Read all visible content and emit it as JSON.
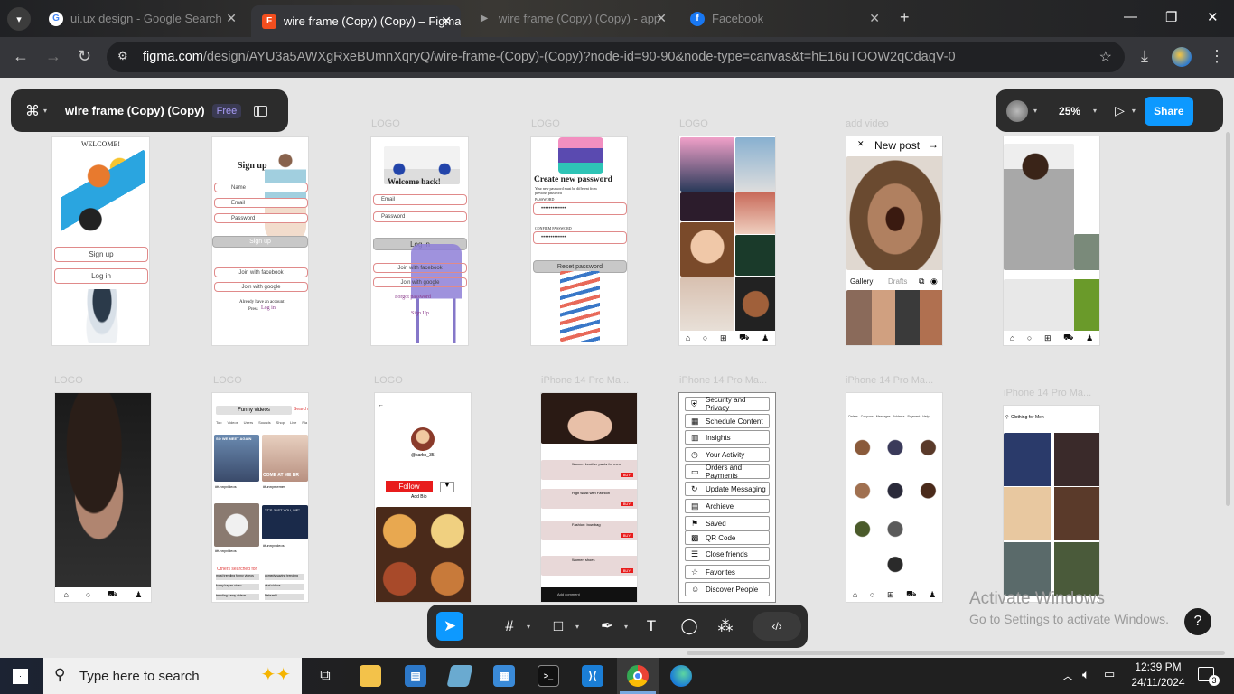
{
  "browser": {
    "tabs": [
      {
        "title": "ui.ux design - Google Search",
        "active": false,
        "icon": "google-icon"
      },
      {
        "title": "wire frame (Copy) (Copy) – Figma",
        "active": true,
        "icon": "figma-icon"
      },
      {
        "title": "wire frame (Copy) (Copy) - app",
        "active": false,
        "icon": "play-icon"
      },
      {
        "title": "Facebook",
        "active": false,
        "icon": "facebook-icon"
      }
    ],
    "url_host": "figma.com",
    "url_path": "/design/AYU3a5AWXgRxeBUmnXqryQ/wire-frame-(Copy)-(Copy)?node-id=90-90&node-type=canvas&t=hE16uTOOW2qCdaqV-0"
  },
  "figma": {
    "file_name": "wire frame (Copy) (Copy)",
    "plan_badge": "Free",
    "zoom": "25%",
    "share_label": "Share",
    "help_label": "?"
  },
  "frames_row1": [
    {
      "label": "",
      "title": "WELCOME!",
      "btn1": "Sign up",
      "btn2": "Log in"
    },
    {
      "label": "",
      "title": "Sign up",
      "f1": "Name",
      "f2": "Email",
      "f3": "Password",
      "btn": "Sign up",
      "s1": "Join with facebook",
      "s2": "Join with google",
      "foot1": "Already have an account",
      "foot2": "Press",
      "foot3": "Log in"
    },
    {
      "label": "LOGO",
      "title": "Welcome back!",
      "f1": "Email",
      "f2": "Password",
      "btn": "Log in",
      "s1": "Join with facebook",
      "s2": "Join with google",
      "forgot": "Forgot password",
      "foot": "Sign Up"
    },
    {
      "label": "LOGO",
      "title": "Create new password",
      "sub": "Your new password must be different from previous password",
      "f1": "PASSWORD",
      "f2": "CONFIRM PASSWORD",
      "dots": "•••••••••••••",
      "btn": "Reset password"
    },
    {
      "label": "LOGO"
    },
    {
      "label": "add video",
      "title": "New post",
      "gallery": "Gallery",
      "drafts": "Drafts"
    },
    {
      "label": ""
    }
  ],
  "frames_row2": [
    {
      "label": "LOGO"
    },
    {
      "label": "LOGO",
      "search": "Funny videos",
      "search_btn": "Search",
      "tabs": [
        "Top",
        "Videos",
        "Users",
        "Sounds",
        "Shop",
        "Live",
        "Pla"
      ],
      "captions": [
        "#funnyvideos",
        "#funnymemes",
        "#funnyvideos",
        "#funnyvideos"
      ],
      "section": "Others searched for",
      "chips": [
        "most trending funny videos",
        "comedy saying trending",
        "funny kagan video",
        "viral videos",
        "trending funny videos",
        "Nebraski"
      ],
      "meme1": "SO WE MEET AGAIN",
      "meme2": "COME AT ME BR",
      "meme3": "\"IT'S JUST YOU, ME\""
    },
    {
      "label": "LOGO",
      "user": "@sarbs_35",
      "follow": "Follow",
      "bio": "Add Bio"
    },
    {
      "label": "iPhone 14 Pro Ma...",
      "products": [
        "Women Leather pants for men",
        "High waist with Fashion",
        "Fashion: bow bag",
        "Women shoes"
      ],
      "buy": "BUY",
      "comment": "Add comment"
    },
    {
      "label": "iPhone 14 Pro Ma...",
      "menu": [
        {
          "label": "Security and Privacy",
          "icon": "shield-icon"
        },
        {
          "label": "Schedule Content",
          "icon": "calendar-icon"
        },
        {
          "label": "Insights",
          "icon": "chart-icon"
        },
        {
          "label": "Your Activity",
          "icon": "clock-icon"
        },
        {
          "label": "Orders and Payments",
          "icon": "card-icon"
        },
        {
          "label": "Update Messaging",
          "icon": "refresh-icon"
        },
        {
          "label": "Archieve",
          "icon": "archive-icon"
        },
        {
          "label": "Saved",
          "icon": "bookmark-icon"
        },
        {
          "label": "QR Code",
          "icon": "qr-icon"
        },
        {
          "label": "Close friends",
          "icon": "list-icon"
        },
        {
          "label": "Favorites",
          "icon": "star-icon"
        },
        {
          "label": "Discover People",
          "icon": "people-icon"
        }
      ]
    },
    {
      "label": "iPhone 14 Pro Ma...",
      "tabs": [
        "Orders",
        "Coupons",
        "Messages",
        "Address",
        "Payment",
        "Help"
      ]
    },
    {
      "label": "iPhone 14 Pro Ma...",
      "search": "Clothing for Men"
    }
  ],
  "watermark": {
    "line1": "Activate Windows",
    "line2": "Go to Settings to activate Windows."
  },
  "taskbar": {
    "search_placeholder": "Type here to search",
    "time": "12:39 PM",
    "date": "24/11/2024",
    "notifications": "3"
  }
}
